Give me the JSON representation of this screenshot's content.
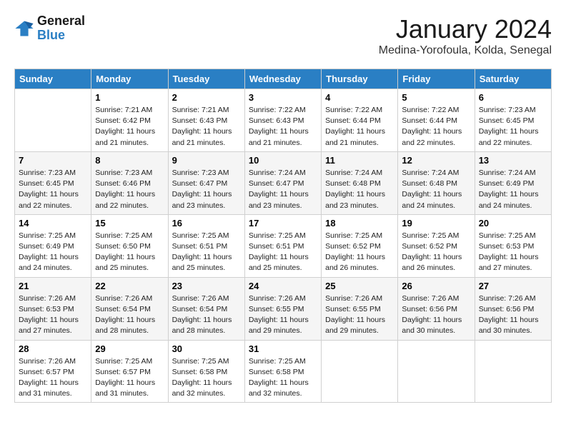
{
  "header": {
    "logo": {
      "line1": "General",
      "line2": "Blue"
    },
    "title": "January 2024",
    "location": "Medina-Yorofoula, Kolda, Senegal"
  },
  "weekdays": [
    "Sunday",
    "Monday",
    "Tuesday",
    "Wednesday",
    "Thursday",
    "Friday",
    "Saturday"
  ],
  "weeks": [
    [
      {
        "day": "",
        "sunrise": "",
        "sunset": "",
        "daylight": ""
      },
      {
        "day": "1",
        "sunrise": "Sunrise: 7:21 AM",
        "sunset": "Sunset: 6:42 PM",
        "daylight": "Daylight: 11 hours and 21 minutes."
      },
      {
        "day": "2",
        "sunrise": "Sunrise: 7:21 AM",
        "sunset": "Sunset: 6:43 PM",
        "daylight": "Daylight: 11 hours and 21 minutes."
      },
      {
        "day": "3",
        "sunrise": "Sunrise: 7:22 AM",
        "sunset": "Sunset: 6:43 PM",
        "daylight": "Daylight: 11 hours and 21 minutes."
      },
      {
        "day": "4",
        "sunrise": "Sunrise: 7:22 AM",
        "sunset": "Sunset: 6:44 PM",
        "daylight": "Daylight: 11 hours and 21 minutes."
      },
      {
        "day": "5",
        "sunrise": "Sunrise: 7:22 AM",
        "sunset": "Sunset: 6:44 PM",
        "daylight": "Daylight: 11 hours and 22 minutes."
      },
      {
        "day": "6",
        "sunrise": "Sunrise: 7:23 AM",
        "sunset": "Sunset: 6:45 PM",
        "daylight": "Daylight: 11 hours and 22 minutes."
      }
    ],
    [
      {
        "day": "7",
        "sunrise": "Sunrise: 7:23 AM",
        "sunset": "Sunset: 6:45 PM",
        "daylight": "Daylight: 11 hours and 22 minutes."
      },
      {
        "day": "8",
        "sunrise": "Sunrise: 7:23 AM",
        "sunset": "Sunset: 6:46 PM",
        "daylight": "Daylight: 11 hours and 22 minutes."
      },
      {
        "day": "9",
        "sunrise": "Sunrise: 7:23 AM",
        "sunset": "Sunset: 6:47 PM",
        "daylight": "Daylight: 11 hours and 23 minutes."
      },
      {
        "day": "10",
        "sunrise": "Sunrise: 7:24 AM",
        "sunset": "Sunset: 6:47 PM",
        "daylight": "Daylight: 11 hours and 23 minutes."
      },
      {
        "day": "11",
        "sunrise": "Sunrise: 7:24 AM",
        "sunset": "Sunset: 6:48 PM",
        "daylight": "Daylight: 11 hours and 23 minutes."
      },
      {
        "day": "12",
        "sunrise": "Sunrise: 7:24 AM",
        "sunset": "Sunset: 6:48 PM",
        "daylight": "Daylight: 11 hours and 24 minutes."
      },
      {
        "day": "13",
        "sunrise": "Sunrise: 7:24 AM",
        "sunset": "Sunset: 6:49 PM",
        "daylight": "Daylight: 11 hours and 24 minutes."
      }
    ],
    [
      {
        "day": "14",
        "sunrise": "Sunrise: 7:25 AM",
        "sunset": "Sunset: 6:49 PM",
        "daylight": "Daylight: 11 hours and 24 minutes."
      },
      {
        "day": "15",
        "sunrise": "Sunrise: 7:25 AM",
        "sunset": "Sunset: 6:50 PM",
        "daylight": "Daylight: 11 hours and 25 minutes."
      },
      {
        "day": "16",
        "sunrise": "Sunrise: 7:25 AM",
        "sunset": "Sunset: 6:51 PM",
        "daylight": "Daylight: 11 hours and 25 minutes."
      },
      {
        "day": "17",
        "sunrise": "Sunrise: 7:25 AM",
        "sunset": "Sunset: 6:51 PM",
        "daylight": "Daylight: 11 hours and 25 minutes."
      },
      {
        "day": "18",
        "sunrise": "Sunrise: 7:25 AM",
        "sunset": "Sunset: 6:52 PM",
        "daylight": "Daylight: 11 hours and 26 minutes."
      },
      {
        "day": "19",
        "sunrise": "Sunrise: 7:25 AM",
        "sunset": "Sunset: 6:52 PM",
        "daylight": "Daylight: 11 hours and 26 minutes."
      },
      {
        "day": "20",
        "sunrise": "Sunrise: 7:25 AM",
        "sunset": "Sunset: 6:53 PM",
        "daylight": "Daylight: 11 hours and 27 minutes."
      }
    ],
    [
      {
        "day": "21",
        "sunrise": "Sunrise: 7:26 AM",
        "sunset": "Sunset: 6:53 PM",
        "daylight": "Daylight: 11 hours and 27 minutes."
      },
      {
        "day": "22",
        "sunrise": "Sunrise: 7:26 AM",
        "sunset": "Sunset: 6:54 PM",
        "daylight": "Daylight: 11 hours and 28 minutes."
      },
      {
        "day": "23",
        "sunrise": "Sunrise: 7:26 AM",
        "sunset": "Sunset: 6:54 PM",
        "daylight": "Daylight: 11 hours and 28 minutes."
      },
      {
        "day": "24",
        "sunrise": "Sunrise: 7:26 AM",
        "sunset": "Sunset: 6:55 PM",
        "daylight": "Daylight: 11 hours and 29 minutes."
      },
      {
        "day": "25",
        "sunrise": "Sunrise: 7:26 AM",
        "sunset": "Sunset: 6:55 PM",
        "daylight": "Daylight: 11 hours and 29 minutes."
      },
      {
        "day": "26",
        "sunrise": "Sunrise: 7:26 AM",
        "sunset": "Sunset: 6:56 PM",
        "daylight": "Daylight: 11 hours and 30 minutes."
      },
      {
        "day": "27",
        "sunrise": "Sunrise: 7:26 AM",
        "sunset": "Sunset: 6:56 PM",
        "daylight": "Daylight: 11 hours and 30 minutes."
      }
    ],
    [
      {
        "day": "28",
        "sunrise": "Sunrise: 7:26 AM",
        "sunset": "Sunset: 6:57 PM",
        "daylight": "Daylight: 11 hours and 31 minutes."
      },
      {
        "day": "29",
        "sunrise": "Sunrise: 7:25 AM",
        "sunset": "Sunset: 6:57 PM",
        "daylight": "Daylight: 11 hours and 31 minutes."
      },
      {
        "day": "30",
        "sunrise": "Sunrise: 7:25 AM",
        "sunset": "Sunset: 6:58 PM",
        "daylight": "Daylight: 11 hours and 32 minutes."
      },
      {
        "day": "31",
        "sunrise": "Sunrise: 7:25 AM",
        "sunset": "Sunset: 6:58 PM",
        "daylight": "Daylight: 11 hours and 32 minutes."
      },
      {
        "day": "",
        "sunrise": "",
        "sunset": "",
        "daylight": ""
      },
      {
        "day": "",
        "sunrise": "",
        "sunset": "",
        "daylight": ""
      },
      {
        "day": "",
        "sunrise": "",
        "sunset": "",
        "daylight": ""
      }
    ]
  ]
}
